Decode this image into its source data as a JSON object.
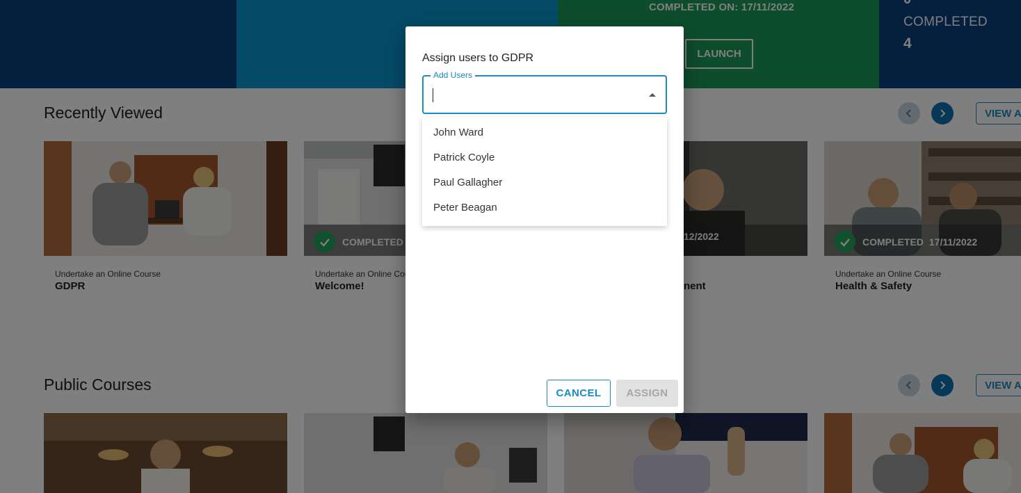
{
  "banner": {
    "completed_on": "COMPLETED ON: 17/11/2022",
    "launch_label": "LAUNCH",
    "stat_top": "0",
    "stat_label": "COMPLETED",
    "stat_value": "4",
    "colors": {
      "navy": "#0a3e7e",
      "blue": "#0a95cc",
      "green": "#1a9b59"
    }
  },
  "recently_viewed": {
    "title": "Recently Viewed",
    "view_all": "VIEW A",
    "cards": [
      {
        "type": "Undertake an Online Course",
        "title": "GDPR",
        "status": "",
        "date": ""
      },
      {
        "type": "Undertake an Online Cou",
        "title": "Welcome!",
        "status": "COMPLETED",
        "date": ""
      },
      {
        "type": "",
        "title": "nent",
        "status": "",
        "date": "12/2022"
      },
      {
        "type": "Undertake an Online Course",
        "title": "Health & Safety",
        "status": "COMPLETED",
        "date": "17/11/2022"
      }
    ]
  },
  "public_courses": {
    "title": "Public Courses",
    "view_all": "VIEW A"
  },
  "dialog": {
    "title": "Assign users to GDPR",
    "field_label": "Add Users",
    "field_value": "",
    "options": [
      "John Ward",
      "Patrick Coyle",
      "Paul Gallagher",
      "Peter Beagan"
    ],
    "cancel_label": "CANCEL",
    "assign_label": "ASSIGN",
    "accent_color": "#1a8ac2"
  }
}
